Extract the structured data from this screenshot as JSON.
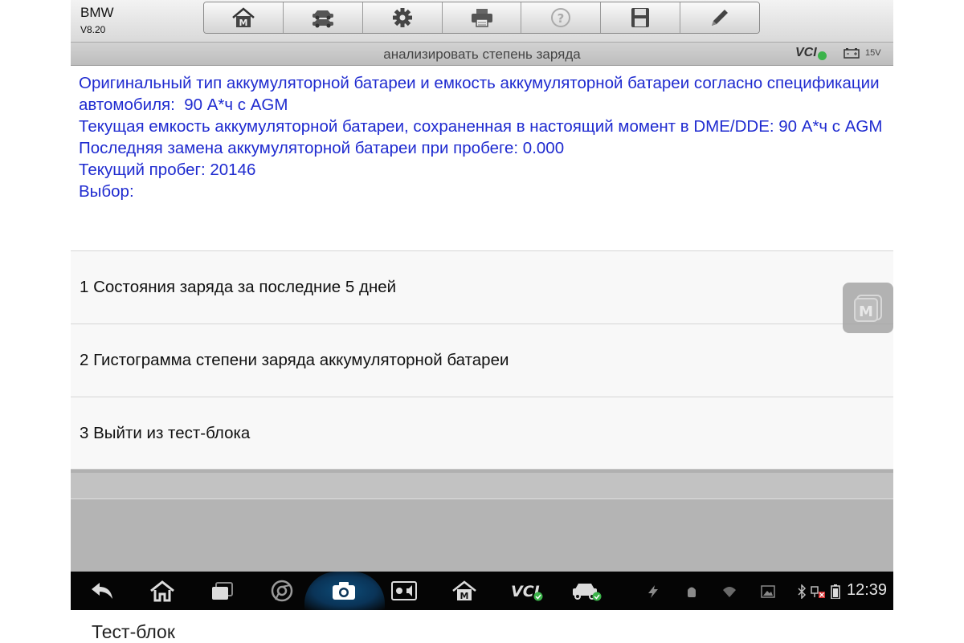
{
  "app": {
    "name": "BMW",
    "version": "V8.20"
  },
  "toolbar": {
    "buttons": [
      {
        "name": "home-button",
        "icon": "maxisys-home-icon"
      },
      {
        "name": "vehicle-swap-button",
        "icon": "car-swap-icon"
      },
      {
        "name": "settings-button",
        "icon": "gear-icon"
      },
      {
        "name": "print-button",
        "icon": "printer-icon"
      },
      {
        "name": "help-button",
        "icon": "help-icon"
      },
      {
        "name": "save-button",
        "icon": "floppy-disk-icon"
      },
      {
        "name": "edit-button",
        "icon": "pencil-icon"
      }
    ]
  },
  "titlebar": {
    "title": "анализировать степень заряда",
    "vci": "VCI",
    "voltage": "15V"
  },
  "info": {
    "text": "Оригинальный тип аккумуляторной батареи и емкость аккумуляторной батареи согласно спецификации автомобиля:  90 А*ч с AGM\nТекущая емкость аккумуляторной батареи, сохраненная в настоящий момент в DME/DDE: 90 А*ч с AGM\nПоследняя замена аккумуляторной батареи при пробеге: 0.000\nТекущий пробег: 20146\nВыбор:"
  },
  "menu": {
    "items": [
      {
        "label": "1 Состояния заряда за последние 5 дней"
      },
      {
        "label": "2 Гистограмма степени заряда аккумуляторной батареи"
      },
      {
        "label": "3 Выйти из тест-блока"
      }
    ]
  },
  "navbar": {
    "icons": [
      "back-icon",
      "home-icon",
      "recent-apps-icon",
      "chrome-icon",
      "camera-icon",
      "brightness-volume-icon",
      "maxisys-home-icon",
      "vci-icon",
      "car-check-icon"
    ],
    "status_icons": [
      "flash-icon",
      "android-debug-icon",
      "wifi-icon",
      "image-icon",
      "bluetooth-icon",
      "network-error-icon",
      "battery-icon"
    ],
    "time": "12:39"
  },
  "caption": "Тест-блок",
  "colors": {
    "info_text": "#1f2bd0",
    "accent_blue": "#0a3458",
    "vci_ok": "#3bb34a"
  }
}
